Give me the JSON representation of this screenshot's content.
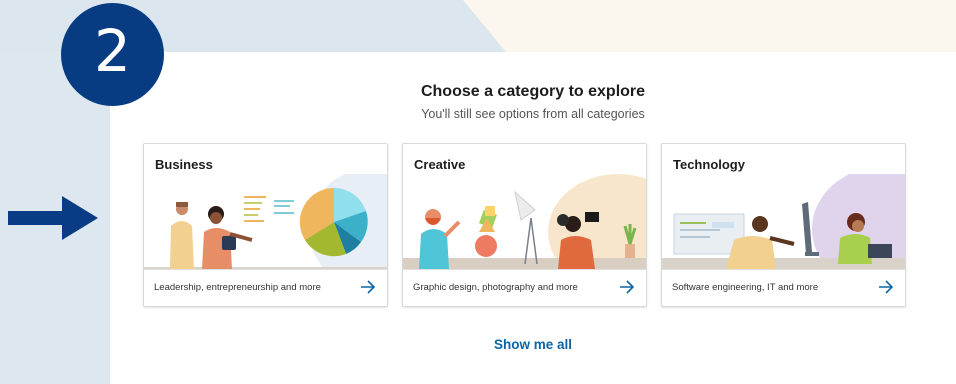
{
  "step": {
    "number": "2"
  },
  "header": {
    "title": "Choose a category to explore",
    "subtitle": "You'll still see options from all categories"
  },
  "categories": [
    {
      "title": "Business",
      "description": "Leadership, entrepreneurship and more",
      "illustration": "business-illustration"
    },
    {
      "title": "Creative",
      "description": "Graphic design, photography and more",
      "illustration": "creative-illustration"
    },
    {
      "title": "Technology",
      "description": "Software engineering, IT and more",
      "illustration": "technology-illustration"
    }
  ],
  "actions": {
    "show_all_label": "Show me all"
  },
  "colors": {
    "step_circle": "#073b82",
    "link": "#0a66a6",
    "arrow": "#0a3c86"
  },
  "icons": {
    "pointer": "right-arrow-icon",
    "card_arrow": "arrow-right-icon"
  }
}
